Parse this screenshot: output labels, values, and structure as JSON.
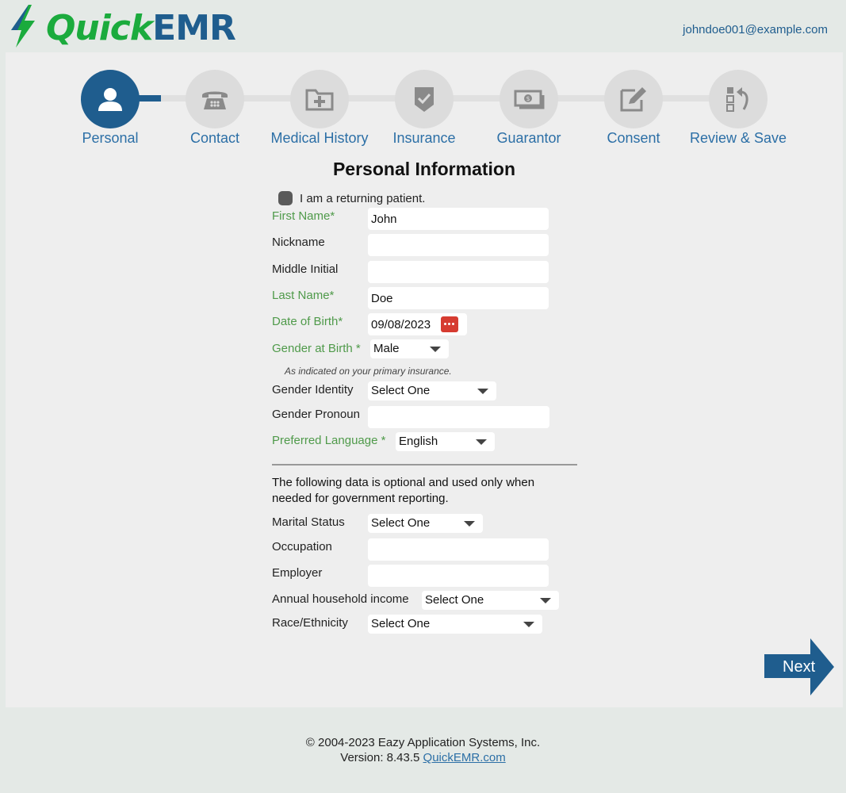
{
  "header": {
    "logo_quick": "Quick",
    "logo_emr": "EMR",
    "user_email": "johndoe001@example.com"
  },
  "steps": [
    {
      "label": "Personal",
      "icon": "person-icon",
      "active": true
    },
    {
      "label": "Contact",
      "icon": "phone-icon",
      "active": false
    },
    {
      "label": "Medical History",
      "icon": "medical-folder-icon",
      "active": false
    },
    {
      "label": "Insurance",
      "icon": "shield-check-icon",
      "active": false
    },
    {
      "label": "Guarantor",
      "icon": "money-icon",
      "active": false
    },
    {
      "label": "Consent",
      "icon": "edit-icon",
      "active": false
    },
    {
      "label": "Review & Save",
      "icon": "review-icon",
      "active": false
    }
  ],
  "form": {
    "title": "Personal Information",
    "returning_label": "I am a returning patient.",
    "first_name": {
      "label": "First Name*",
      "value": "John"
    },
    "nickname": {
      "label": "Nickname",
      "value": ""
    },
    "middle_initial": {
      "label": "Middle Initial",
      "value": ""
    },
    "last_name": {
      "label": "Last Name*",
      "value": "Doe"
    },
    "dob": {
      "label": "Date of Birth*",
      "value": "09/08/2023"
    },
    "gender_birth": {
      "label": "Gender at Birth *",
      "value": "Male",
      "note": "As indicated on your primary insurance."
    },
    "gender_identity": {
      "label": "Gender Identity",
      "value": "Select One"
    },
    "gender_pronoun": {
      "label": "Gender Pronoun",
      "value": ""
    },
    "language": {
      "label": "Preferred Language *",
      "value": "English"
    },
    "optional_text": "The following data is optional and used only when needed for government reporting.",
    "marital": {
      "label": "Marital Status",
      "value": "Select One"
    },
    "occupation": {
      "label": "Occupation",
      "value": ""
    },
    "employer": {
      "label": "Employer",
      "value": ""
    },
    "income": {
      "label": "Annual household income",
      "value": "Select One"
    },
    "race": {
      "label": "Race/Ethnicity",
      "value": "Select One"
    }
  },
  "next_label": "Next",
  "footer": {
    "copyright": "© 2004-2023 Eazy Application Systems, Inc.",
    "version_prefix": "Version: 8.43.5",
    "link_text": "QuickEMR.com"
  },
  "colors": {
    "brand_blue": "#1f5d8e",
    "brand_green": "#1bab3d",
    "required_green": "#4f9a4a",
    "date_red": "#d63b30"
  }
}
